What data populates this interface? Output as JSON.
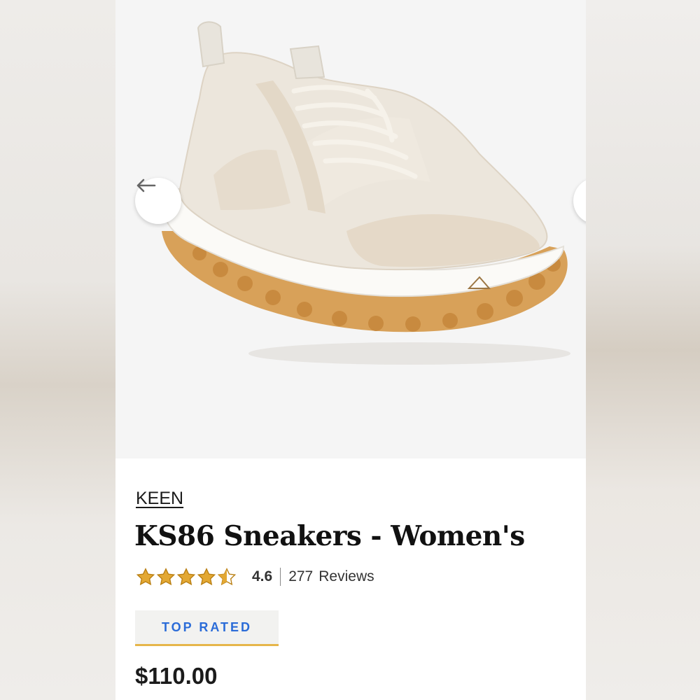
{
  "product": {
    "brand": "KEEN",
    "title": "KS86 Sneakers - Women's",
    "rating": {
      "value": 4.6,
      "value_label": "4.6",
      "stars_total": 5,
      "review_count": "277",
      "review_label": "Reviews"
    },
    "badge": "TOP RATED",
    "price": "$110.00"
  },
  "gallery": {
    "prev_icon": "arrow-left-icon",
    "next_icon": "arrow-right-icon"
  },
  "colors": {
    "badge_text": "#2b6cd8",
    "badge_underline": "#e6b64a",
    "star_fill": "#e3a833",
    "star_outline": "#b97f13"
  }
}
